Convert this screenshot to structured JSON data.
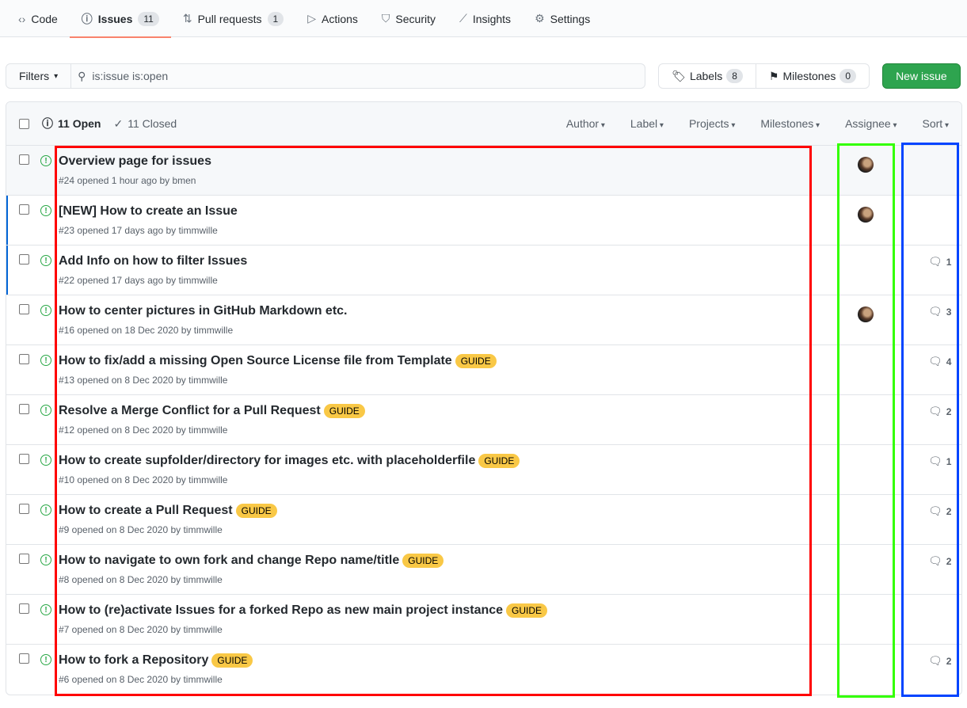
{
  "tabs": [
    {
      "label": "Code",
      "icon": "code-icon",
      "glyph": "‹›"
    },
    {
      "label": "Issues",
      "icon": "issue-opened-icon",
      "glyph": "ⓘ",
      "count": "11",
      "selected": true
    },
    {
      "label": "Pull requests",
      "icon": "git-pull-request-icon",
      "glyph": "⇅",
      "count": "1"
    },
    {
      "label": "Actions",
      "icon": "play-icon",
      "glyph": "▷"
    },
    {
      "label": "Security",
      "icon": "shield-icon",
      "glyph": "⛉"
    },
    {
      "label": "Insights",
      "icon": "graph-icon",
      "glyph": "⟋"
    },
    {
      "label": "Settings",
      "icon": "gear-icon",
      "glyph": "⚙"
    }
  ],
  "toolbar": {
    "filters": "Filters",
    "search_value": "is:issue is:open",
    "labels": "Labels",
    "labels_count": "8",
    "milestones": "Milestones",
    "milestones_count": "0",
    "new_issue": "New issue"
  },
  "header": {
    "open": "11 Open",
    "closed": "11 Closed",
    "dropdowns": [
      "Author",
      "Label",
      "Projects",
      "Milestones",
      "Assignee",
      "Sort"
    ]
  },
  "colors": {
    "accent": "#f9826c",
    "label_guide": "#f9c846",
    "new_issue": "#2ea44f",
    "open_icon": "#28a745"
  },
  "issues": [
    {
      "title": "Overview page for issues",
      "meta": "#24 opened 1 hour ago by bmen",
      "assignee": true,
      "comments": ""
    },
    {
      "title": "[NEW] How to create an Issue",
      "meta": "#23 opened 17 days ago by timmwille",
      "assignee": true,
      "comments": ""
    },
    {
      "title": "Add Info on how to filter Issues",
      "meta": "#22 opened 17 days ago by timmwille",
      "assignee": false,
      "comments": "1"
    },
    {
      "title": "How to center pictures in GitHub Markdown etc.",
      "meta": "#16 opened on 18 Dec 2020 by timmwille",
      "assignee": true,
      "comments": "3"
    },
    {
      "title": "How to fix/add a missing Open Source License file from Template",
      "label": "GUIDE",
      "meta": "#13 opened on 8 Dec 2020 by timmwille",
      "assignee": false,
      "comments": "4"
    },
    {
      "title": "Resolve a Merge Conflict for a Pull Request",
      "label": "GUIDE",
      "meta": "#12 opened on 8 Dec 2020 by timmwille",
      "assignee": false,
      "comments": "2"
    },
    {
      "title": "How to create supfolder/directory for images etc. with placeholderfile",
      "label": "GUIDE",
      "meta": "#10 opened on 8 Dec 2020 by timmwille",
      "assignee": false,
      "comments": "1"
    },
    {
      "title": "How to create a Pull Request",
      "label": "GUIDE",
      "meta": "#9 opened on 8 Dec 2020 by timmwille",
      "assignee": false,
      "comments": "2"
    },
    {
      "title": "How to navigate to own fork and change Repo name/title",
      "label": "GUIDE",
      "meta": "#8 opened on 8 Dec 2020 by timmwille",
      "assignee": false,
      "comments": "2"
    },
    {
      "title": "How to (re)activate Issues for a forked Repo as new main project instance",
      "label": "GUIDE",
      "meta": "#7 opened on 8 Dec 2020 by timmwille",
      "assignee": false,
      "comments": ""
    },
    {
      "title": "How to fork a Repository",
      "label": "GUIDE",
      "meta": "#6 opened on 8 Dec 2020 by timmwille",
      "assignee": false,
      "comments": "2"
    }
  ]
}
